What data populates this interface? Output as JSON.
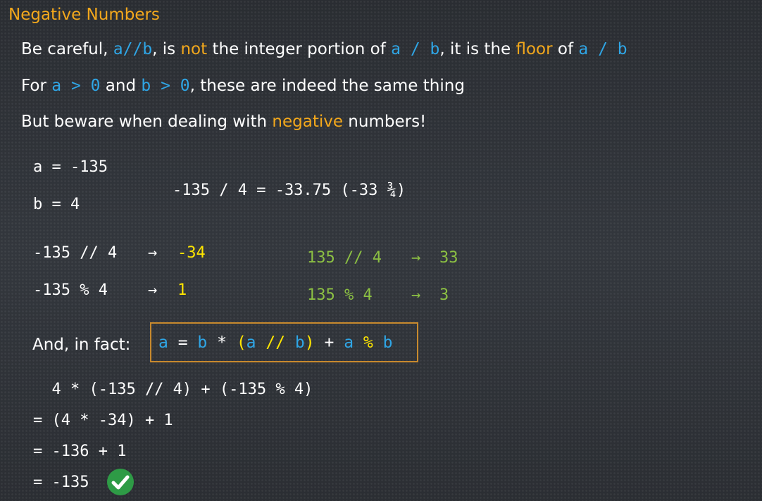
{
  "title": "Negative Numbers",
  "line1": {
    "t1": "Be careful, ",
    "c1": "a//b",
    "t2": ", is ",
    "not": "not",
    "t3": " the integer portion of ",
    "c2": "a / b",
    "t4": ", it is the ",
    "floor": "floor",
    "t5": " of ",
    "c3": "a / b"
  },
  "line2": {
    "t1": "For ",
    "c1": "a > 0",
    "t2": " and ",
    "c2": "b > 0",
    "t3": ", these are indeed the same thing"
  },
  "line3": {
    "t1": "But beware when dealing with ",
    "negative": "negative",
    "t2": " numbers!"
  },
  "assign_a": "a = -135",
  "assign_b": "b = 4",
  "division": "-135 / 4 = -33.75 (-33 ¾)",
  "neg_floordiv": {
    "expr": "-135 // 4",
    "arrow": "→",
    "result": "-34"
  },
  "neg_mod": {
    "expr": "-135 % 4",
    "arrow": "→",
    "result": "1"
  },
  "pos_floordiv": {
    "expr": "135 // 4",
    "arrow": "→",
    "result": "33"
  },
  "pos_mod": {
    "expr": "135 % 4",
    "arrow": "→",
    "result": "3"
  },
  "fact_label": "And, in fact:",
  "identity": {
    "a1": "a",
    "eq": " = ",
    "b1": "b",
    "mul": " * ",
    "lp": "(",
    "a2": "a",
    "fd": " // ",
    "b2": "b",
    "rp": ")",
    "plus": " + ",
    "a3": "a",
    "mod": " % ",
    "b3": "b"
  },
  "steps": [
    "  4 * (-135 // 4) + (-135 % 4)",
    "= (4 * -34) + 1",
    "= -136 + 1",
    "= -135"
  ],
  "icons": {
    "check": "check-circle-icon"
  },
  "colors": {
    "blue": "#2fa6e6",
    "orange": "#f3a81c",
    "yellow": "#ffe600",
    "green": "#8cc043",
    "check": "#2e9b46"
  }
}
